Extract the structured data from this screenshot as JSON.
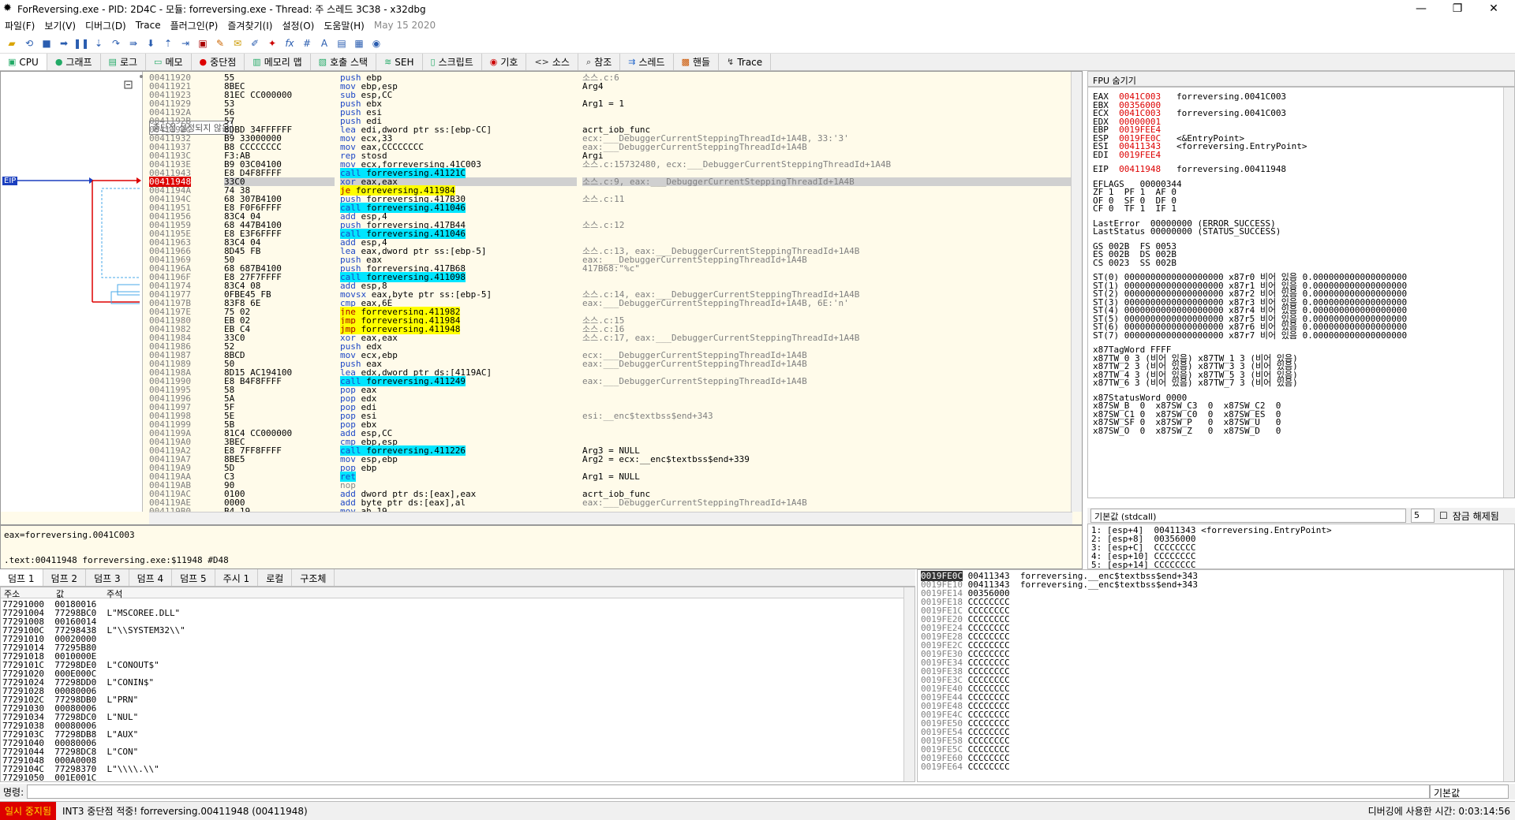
{
  "title": "ForReversing.exe - PID: 2D4C - 모듈: forreversing.exe - Thread: 주 스레드 3C38 - x32dbg",
  "menu": [
    "파일(F)",
    "보기(V)",
    "디버그(D)",
    "Trace",
    "플러그인(P)",
    "즐겨찾기(I)",
    "설정(O)",
    "도움말(H)"
  ],
  "menu_date": "May 15 2020",
  "tabs": [
    "CPU",
    "그래프",
    "로그",
    "메모",
    "중단점",
    "메모리 맵",
    "호출 스택",
    "SEH",
    "스크립트",
    "기호",
    "소스",
    "참조",
    "스레드",
    "핸들",
    "Trace"
  ],
  "tooltip": "중단점 설정되지 않음",
  "eip_label": "EIP",
  "disasm": [
    [
      "00411920",
      "55",
      "push ebp",
      "소스.c:6"
    ],
    [
      "00411921",
      "8BEC",
      "mov ebp,esp",
      "Arg4"
    ],
    [
      "00411923",
      "81EC CC000000",
      "sub esp,CC",
      ""
    ],
    [
      "00411929",
      "53",
      "push ebx",
      "Arg1 = 1"
    ],
    [
      "0041192A",
      "56",
      "push esi",
      ""
    ],
    [
      "0041192B",
      "57",
      "push edi",
      ""
    ],
    [
      "0041192C",
      "8DBD 34FFFFFF",
      "lea edi,dword ptr ss:[ebp-CC]",
      "acrt_iob_func"
    ],
    [
      "00411932",
      "B9 33000000",
      "mov ecx,33",
      "ecx:___DebuggerCurrentSteppingThreadId+1A4B, 33:'3'"
    ],
    [
      "00411937",
      "B8 CCCCCCCC",
      "mov eax,CCCCCCCC",
      "eax:___DebuggerCurrentSteppingThreadId+1A4B"
    ],
    [
      "0041193C",
      "F3:AB",
      "rep stosd",
      "Argi"
    ],
    [
      "0041193E",
      "B9 03C04100",
      "mov ecx,forreversing.41C003",
      "소스.c:15732480, ecx:___DebuggerCurrentSteppingThreadId+1A4B"
    ],
    [
      "00411943",
      "E8 D4F8FFFF",
      "call forreversing.41121C",
      ""
    ],
    [
      "00411948",
      "33C0",
      "xor eax,eax",
      "소스.c:9, eax:___DebuggerCurrentSteppingThreadId+1A4B"
    ],
    [
      "0041194A",
      "74 38",
      "je forreversing.411984",
      ""
    ],
    [
      "0041194C",
      "68 307B4100",
      "push forreversing.417B30",
      "소스.c:11"
    ],
    [
      "00411951",
      "E8 F0F6FFFF",
      "call forreversing.411046",
      ""
    ],
    [
      "00411956",
      "83C4 04",
      "add esp,4",
      ""
    ],
    [
      "00411959",
      "68 447B4100",
      "push forreversing.417B44",
      "소스.c:12"
    ],
    [
      "0041195E",
      "E8 E3F6FFFF",
      "call forreversing.411046",
      ""
    ],
    [
      "00411963",
      "83C4 04",
      "add esp,4",
      ""
    ],
    [
      "00411966",
      "8D45 FB",
      "lea eax,dword ptr ss:[ebp-5]",
      "소스.c:13, eax:___DebuggerCurrentSteppingThreadId+1A4B"
    ],
    [
      "00411969",
      "50",
      "push eax",
      "eax:___DebuggerCurrentSteppingThreadId+1A4B"
    ],
    [
      "0041196A",
      "68 687B4100",
      "push forreversing.417B68",
      "417B68:\"%c\""
    ],
    [
      "0041196F",
      "E8 27F7FFFF",
      "call forreversing.411098",
      ""
    ],
    [
      "00411974",
      "83C4 08",
      "add esp,8",
      ""
    ],
    [
      "00411977",
      "0FBE45 FB",
      "movsx eax,byte ptr ss:[ebp-5]",
      "소스.c:14, eax:___DebuggerCurrentSteppingThreadId+1A4B"
    ],
    [
      "0041197B",
      "83F8 6E",
      "cmp eax,6E",
      "eax:___DebuggerCurrentSteppingThreadId+1A4B, 6E:'n'"
    ],
    [
      "0041197E",
      "75 02",
      "jne forreversing.411982",
      ""
    ],
    [
      "00411980",
      "EB 02",
      "jmp forreversing.411984",
      "소스.c:15"
    ],
    [
      "00411982",
      "EB C4",
      "jmp forreversing.411948",
      "소스.c:16"
    ],
    [
      "00411984",
      "33C0",
      "xor eax,eax",
      "소스.c:17, eax:___DebuggerCurrentSteppingThreadId+1A4B"
    ],
    [
      "00411986",
      "52",
      "push edx",
      ""
    ],
    [
      "00411987",
      "8BCD",
      "mov ecx,ebp",
      "ecx:___DebuggerCurrentSteppingThreadId+1A4B"
    ],
    [
      "00411989",
      "50",
      "push eax",
      "eax:___DebuggerCurrentSteppingThreadId+1A4B"
    ],
    [
      "0041198A",
      "8D15 AC194100",
      "lea edx,dword ptr ds:[4119AC]",
      ""
    ],
    [
      "00411990",
      "E8 B4F8FFFF",
      "call forreversing.411249",
      "eax:___DebuggerCurrentSteppingThreadId+1A4B"
    ],
    [
      "00411995",
      "58",
      "pop eax",
      ""
    ],
    [
      "00411996",
      "5A",
      "pop edx",
      ""
    ],
    [
      "00411997",
      "5F",
      "pop edi",
      ""
    ],
    [
      "00411998",
      "5E",
      "pop esi",
      "esi:__enc$textbss$end+343"
    ],
    [
      "00411999",
      "5B",
      "pop ebx",
      ""
    ],
    [
      "0041199A",
      "81C4 CC000000",
      "add esp,CC",
      ""
    ],
    [
      "004119A0",
      "3BEC",
      "cmp ebp,esp",
      ""
    ],
    [
      "004119A2",
      "E8 7FF8FFFF",
      "call forreversing.411226",
      "Arg3 = NULL"
    ],
    [
      "004119A7",
      "8BE5",
      "mov esp,ebp",
      "Arg2 = ecx:__enc$textbss$end+339"
    ],
    [
      "004119A9",
      "5D",
      "pop ebp",
      ""
    ],
    [
      "004119AA",
      "C3",
      "ret",
      "Arg1 = NULL"
    ],
    [
      "004119AB",
      "90",
      "nop",
      ""
    ],
    [
      "004119AC",
      "0100",
      "add dword ptr ds:[eax],eax",
      "acrt_iob_func"
    ],
    [
      "004119AE",
      "0000",
      "add byte ptr ds:[eax],al",
      "eax:___DebuggerCurrentSteppingThreadId+1A4B"
    ],
    [
      "004119B0",
      "B4 19",
      "mov ah,19",
      ""
    ]
  ],
  "info_line1": "eax=forreversing.0041C003",
  "info_line2": ".text:00411948 forreversing.exe:$11948 #D48",
  "reg_header": "FPU 숨기기",
  "registers": [
    [
      "EAX",
      "0041C003",
      "forreversing.0041C003"
    ],
    [
      "EBX",
      "00356000",
      ""
    ],
    [
      "ECX",
      "0041C003",
      "forreversing.0041C003"
    ],
    [
      "EDX",
      "00000001",
      ""
    ],
    [
      "EBP",
      "0019FEE4",
      ""
    ],
    [
      "ESP",
      "0019FE0C",
      "<&EntryPoint>"
    ],
    [
      "ESI",
      "00411343",
      "<forreversing.EntryPoint>"
    ],
    [
      "EDI",
      "0019FEE4",
      ""
    ]
  ],
  "eip_reg": [
    "EIP",
    "00411948",
    "forreversing.00411948"
  ],
  "eflags": "EFLAGS   00000344",
  "flags": [
    "ZF 1  PF 1  AF 0",
    "OF 0  SF 0  DF 0",
    "CF 0  TF 1  IF 1"
  ],
  "lasterr": [
    "LastError  00000000 (ERROR_SUCCESS)",
    "LastStatus 00000000 (STATUS_SUCCESS)"
  ],
  "segs": [
    "GS 002B  FS 0053",
    "ES 002B  DS 002B",
    "CS 0023  SS 002B"
  ],
  "st": [
    "ST(0) 0000000000000000000 x87r0 비어 있음 0.000000000000000000",
    "ST(1) 0000000000000000000 x87r1 비어 있음 0.000000000000000000",
    "ST(2) 0000000000000000000 x87r2 비어 있음 0.000000000000000000",
    "ST(3) 0000000000000000000 x87r3 비어 있음 0.000000000000000000",
    "ST(4) 0000000000000000000 x87r4 비어 있음 0.000000000000000000",
    "ST(5) 0000000000000000000 x87r5 비어 있음 0.000000000000000000",
    "ST(6) 0000000000000000000 x87r6 비어 있음 0.000000000000000000",
    "ST(7) 0000000000000000000 x87r7 비어 있음 0.000000000000000000"
  ],
  "tag": [
    "x87TagWord FFFF",
    "x87TW_0 3 (비어 있음) x87TW_1 3 (비어 있음)",
    "x87TW_2 3 (비어 있음) x87TW_3 3 (비어 있음)",
    "x87TW_4 3 (비어 있음) x87TW_5 3 (비어 있음)",
    "x87TW_6 3 (비어 있음) x87TW_7 3 (비어 있음)"
  ],
  "sw": [
    "x87StatusWord 0000",
    "x87SW_B  0  x87SW_C3  0  x87SW_C2  0",
    "x87SW_C1 0  x87SW_C0  0  x87SW_ES  0",
    "x87SW_SF 0  x87SW_P   0  x87SW_U   0",
    "x87SW_O  0  x87SW_Z   0  x87SW_D   0"
  ],
  "callconv": "기본값 (stdcall)",
  "callcount": "5",
  "unlock": "잠금 해제됨",
  "callargs": [
    "1: [esp+4]  00411343 <forreversing.EntryPoint>",
    "2: [esp+8]  00356000",
    "3: [esp+C]  CCCCCCCC",
    "4: [esp+10] CCCCCCCC",
    "5: [esp+14] CCCCCCCC"
  ],
  "dumptabs": [
    "덤프 1",
    "덤프 2",
    "덤프 3",
    "덤프 4",
    "덤프 5",
    "주시 1",
    "로컬",
    "구조체"
  ],
  "dumphdr": [
    "주소",
    "값",
    "주석"
  ],
  "dump": [
    [
      "77291000",
      "00180016",
      ""
    ],
    [
      "77291004",
      "77298BC0",
      "L\"MSCOREE.DLL\""
    ],
    [
      "77291008",
      "00160014",
      ""
    ],
    [
      "7729100C",
      "77298438",
      "L\"\\\\SYSTEM32\\\\\""
    ],
    [
      "77291010",
      "00020000",
      ""
    ],
    [
      "77291014",
      "77295B80",
      ""
    ],
    [
      "77291018",
      "0010000E",
      ""
    ],
    [
      "7729101C",
      "77298DE0",
      "L\"CONOUT$\""
    ],
    [
      "77291020",
      "000E000C",
      ""
    ],
    [
      "77291024",
      "77298DD0",
      "L\"CONIN$\""
    ],
    [
      "77291028",
      "00080006",
      ""
    ],
    [
      "7729102C",
      "77298DB0",
      "L\"PRN\""
    ],
    [
      "77291030",
      "00080006",
      ""
    ],
    [
      "77291034",
      "77298DC0",
      "L\"NUL\""
    ],
    [
      "77291038",
      "00080006",
      ""
    ],
    [
      "7729103C",
      "77298DB8",
      "L\"AUX\""
    ],
    [
      "77291040",
      "00080006",
      ""
    ],
    [
      "77291044",
      "77298DC8",
      "L\"CON\""
    ],
    [
      "77291048",
      "000A0008",
      ""
    ],
    [
      "7729104C",
      "77298370",
      "L\"\\\\\\\\.\\\\\""
    ],
    [
      "77291050",
      "001E001C",
      ""
    ]
  ],
  "stack": [
    [
      "0019FE0C",
      "00411343",
      "forreversing.__enc$textbss$end+343"
    ],
    [
      "0019FE10",
      "00411343",
      "forreversing.__enc$textbss$end+343"
    ],
    [
      "0019FE14",
      "00356000",
      ""
    ],
    [
      "0019FE18",
      "CCCCCCCC",
      ""
    ],
    [
      "0019FE1C",
      "CCCCCCCC",
      ""
    ],
    [
      "0019FE20",
      "CCCCCCCC",
      ""
    ],
    [
      "0019FE24",
      "CCCCCCCC",
      ""
    ],
    [
      "0019FE28",
      "CCCCCCCC",
      ""
    ],
    [
      "0019FE2C",
      "CCCCCCCC",
      ""
    ],
    [
      "0019FE30",
      "CCCCCCCC",
      ""
    ],
    [
      "0019FE34",
      "CCCCCCCC",
      ""
    ],
    [
      "0019FE38",
      "CCCCCCCC",
      ""
    ],
    [
      "0019FE3C",
      "CCCCCCCC",
      ""
    ],
    [
      "0019FE40",
      "CCCCCCCC",
      ""
    ],
    [
      "0019FE44",
      "CCCCCCCC",
      ""
    ],
    [
      "0019FE48",
      "CCCCCCCC",
      ""
    ],
    [
      "0019FE4C",
      "CCCCCCCC",
      ""
    ],
    [
      "0019FE50",
      "CCCCCCCC",
      ""
    ],
    [
      "0019FE54",
      "CCCCCCCC",
      ""
    ],
    [
      "0019FE58",
      "CCCCCCCC",
      ""
    ],
    [
      "0019FE5C",
      "CCCCCCCC",
      ""
    ],
    [
      "0019FE60",
      "CCCCCCCC",
      ""
    ],
    [
      "0019FE64",
      "CCCCCCCC",
      ""
    ]
  ],
  "cmd_label": "명령:",
  "cmd_default": "기본값",
  "status_paused": "일시 중지됨",
  "status_msg": "INT3 중단점 적중! forreversing.00411948 (00411948)",
  "status_time": "디버깅에 사용한 시간: 0:03:14:56"
}
